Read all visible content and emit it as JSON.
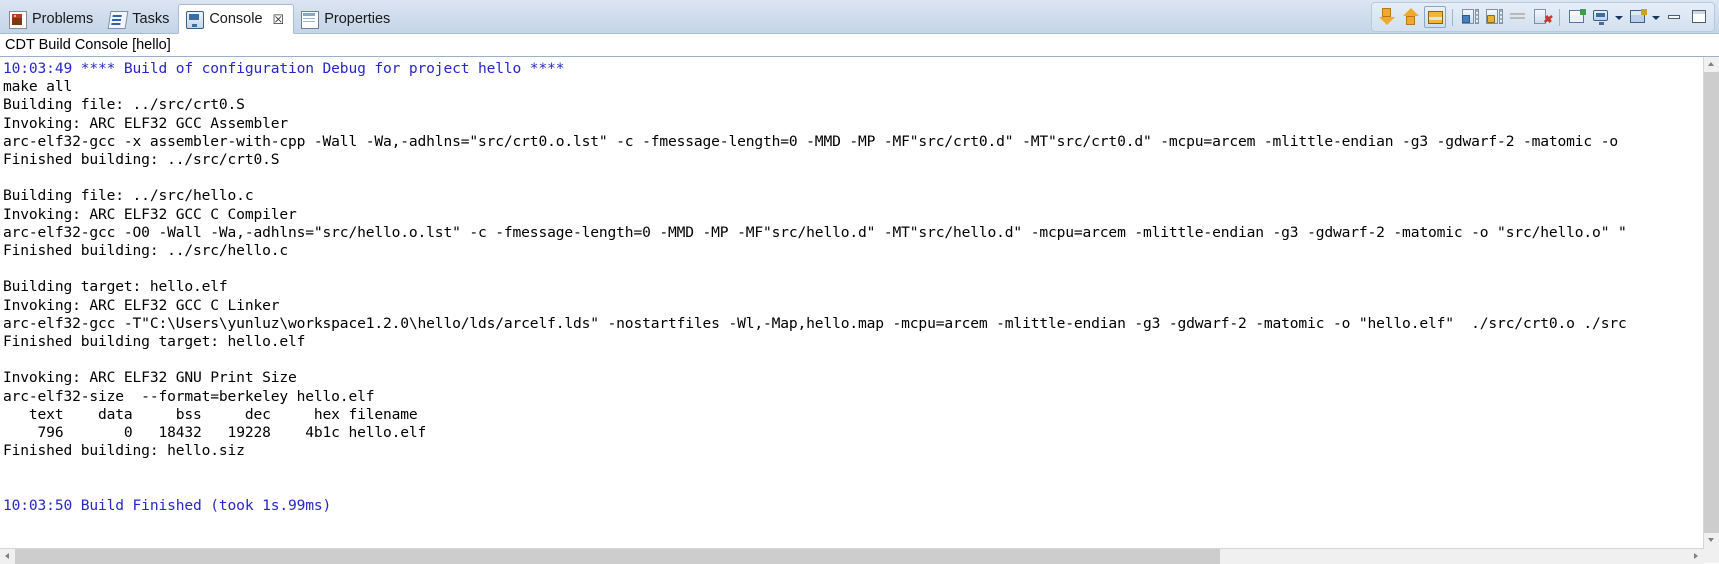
{
  "tabs": [
    {
      "label": "Problems",
      "icon": "problems-icon",
      "active": false,
      "closeable": false
    },
    {
      "label": "Tasks",
      "icon": "tasks-icon",
      "active": false,
      "closeable": false
    },
    {
      "label": "Console",
      "icon": "console-icon",
      "active": true,
      "closeable": true,
      "close_glyph": "☒"
    },
    {
      "label": "Properties",
      "icon": "properties-icon",
      "active": false,
      "closeable": false
    }
  ],
  "toolbar": {
    "buttons": [
      {
        "name": "scroll-down-icon",
        "title": "Scroll Lock Down"
      },
      {
        "name": "scroll-up-icon",
        "title": "Scroll Lock Up"
      },
      {
        "name": "scroll-lock-icon",
        "title": "Scroll Lock",
        "pressed": true
      },
      {
        "name": "save-console-icon",
        "title": "Save Console Output"
      },
      {
        "name": "pin-console-icon",
        "title": "Pin Console"
      },
      {
        "name": "clear-output-icon",
        "title": "Clear Output",
        "disabled": true
      },
      {
        "name": "clear-console-icon",
        "title": "Clear Console"
      },
      {
        "name": "new-console-view-icon",
        "title": "Open Console View"
      },
      {
        "name": "display-console-icon",
        "title": "Display Selected Console"
      },
      {
        "name": "display-console-dropdown-icon",
        "title": "Display Selected Console Menu"
      },
      {
        "name": "open-console-icon",
        "title": "Open Console"
      },
      {
        "name": "open-console-dropdown-icon",
        "title": "Open Console Menu"
      },
      {
        "name": "minimize-icon",
        "title": "Minimize"
      },
      {
        "name": "maximize-icon",
        "title": "Maximize"
      }
    ]
  },
  "console": {
    "title": "CDT Build Console [hello]",
    "lines": [
      {
        "text": "10:03:49 **** Build of configuration Debug for project hello ****",
        "color": "blue"
      },
      {
        "text": "make all",
        "color": "black"
      },
      {
        "text": "Building file: ../src/crt0.S",
        "color": "black"
      },
      {
        "text": "Invoking: ARC ELF32 GCC Assembler",
        "color": "black"
      },
      {
        "text": "arc-elf32-gcc -x assembler-with-cpp -Wall -Wa,-adhlns=\"src/crt0.o.lst\" -c -fmessage-length=0 -MMD -MP -MF\"src/crt0.d\" -MT\"src/crt0.d\" -mcpu=arcem -mlittle-endian -g3 -gdwarf-2 -matomic -o",
        "color": "black"
      },
      {
        "text": "Finished building: ../src/crt0.S",
        "color": "black"
      },
      {
        "text": "",
        "color": "black"
      },
      {
        "text": "Building file: ../src/hello.c",
        "color": "black"
      },
      {
        "text": "Invoking: ARC ELF32 GCC C Compiler",
        "color": "black"
      },
      {
        "text": "arc-elf32-gcc -O0 -Wall -Wa,-adhlns=\"src/hello.o.lst\" -c -fmessage-length=0 -MMD -MP -MF\"src/hello.d\" -MT\"src/hello.d\" -mcpu=arcem -mlittle-endian -g3 -gdwarf-2 -matomic -o \"src/hello.o\" \"",
        "color": "black"
      },
      {
        "text": "Finished building: ../src/hello.c",
        "color": "black"
      },
      {
        "text": "",
        "color": "black"
      },
      {
        "text": "Building target: hello.elf",
        "color": "black"
      },
      {
        "text": "Invoking: ARC ELF32 GCC C Linker",
        "color": "black"
      },
      {
        "text": "arc-elf32-gcc -T\"C:\\Users\\yunluz\\workspace1.2.0\\hello/lds/arcelf.lds\" -nostartfiles -Wl,-Map,hello.map -mcpu=arcem -mlittle-endian -g3 -gdwarf-2 -matomic -o \"hello.elf\"  ./src/crt0.o ./src",
        "color": "black"
      },
      {
        "text": "Finished building target: hello.elf",
        "color": "black"
      },
      {
        "text": "",
        "color": "black"
      },
      {
        "text": "Invoking: ARC ELF32 GNU Print Size",
        "color": "black"
      },
      {
        "text": "arc-elf32-size  --format=berkeley hello.elf",
        "color": "black"
      },
      {
        "text": "   text\t   data\t    bss\t    dec\t    hex\tfilename",
        "color": "black"
      },
      {
        "text": "    796\t      0\t  18432\t  19228\t   4b1c\thello.elf",
        "color": "black"
      },
      {
        "text": "Finished building: hello.siz",
        "color": "black"
      },
      {
        "text": "",
        "color": "black"
      },
      {
        "text": "",
        "color": "black"
      },
      {
        "text": "10:03:50 Build Finished (took 1s.99ms)",
        "color": "blue"
      }
    ],
    "size_table": {
      "type": "table",
      "headers": [
        "text",
        "data",
        "bss",
        "dec",
        "hex",
        "filename"
      ],
      "rows": [
        [
          "796",
          "0",
          "18432",
          "19228",
          "4b1c",
          "hello.elf"
        ]
      ]
    }
  },
  "colors": {
    "console_blue": "#2727c8",
    "console_black": "#000000",
    "tabbar_bg": "#cfdcec",
    "console_bg": "#ffffff"
  }
}
